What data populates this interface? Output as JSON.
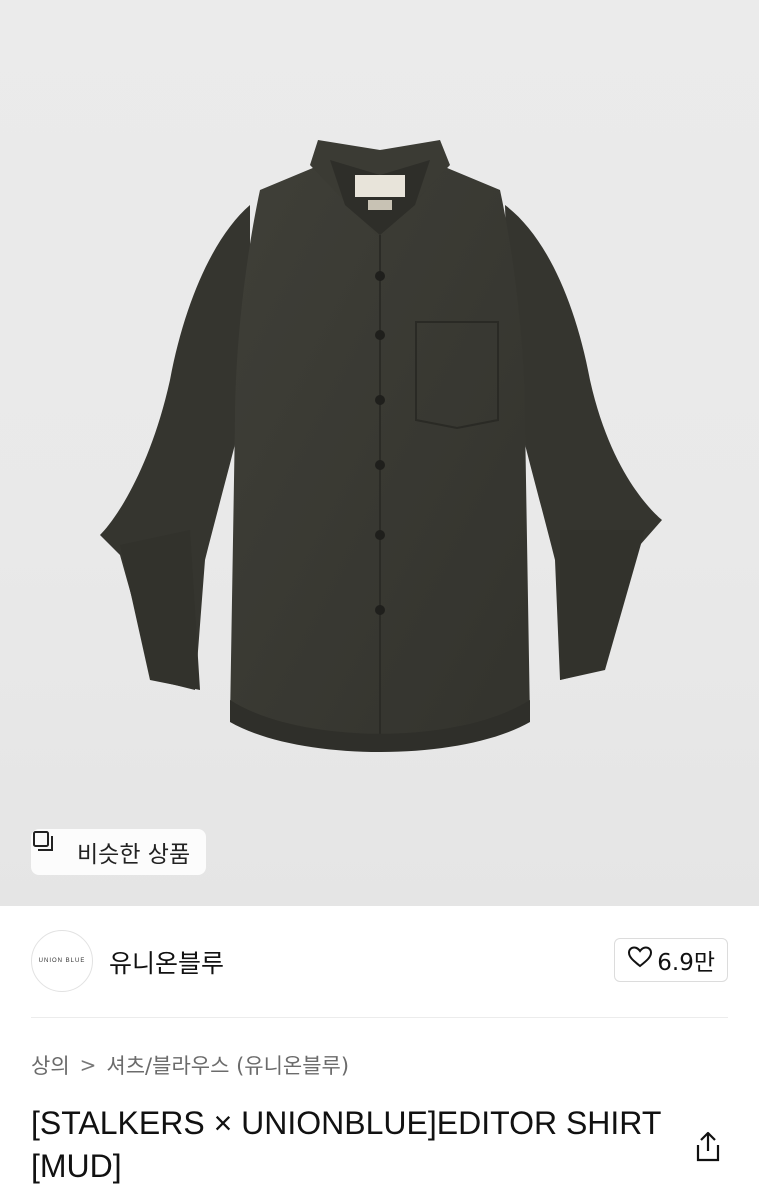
{
  "product_image": {
    "alt": "",
    "colors": {
      "background": "#ebebeb",
      "shirt": "#3a3a33",
      "shirt_shadow": "#2c2c27"
    }
  },
  "similar_button": {
    "label": "비슷한 상품",
    "icon": "stacked-squares-icon"
  },
  "brand": {
    "logo_text": "UNION BLUE",
    "name": "유니온블루"
  },
  "like": {
    "icon": "heart-outline-icon",
    "count": "6.9만"
  },
  "breadcrumb": {
    "category": "상의",
    "separator": ">",
    "subcategory": "셔츠/블라우스 (유니온블루)"
  },
  "product": {
    "title": "[STALKERS × UNIONBLUE]EDITOR SHIRT [MUD]"
  },
  "share": {
    "icon": "share-icon"
  }
}
